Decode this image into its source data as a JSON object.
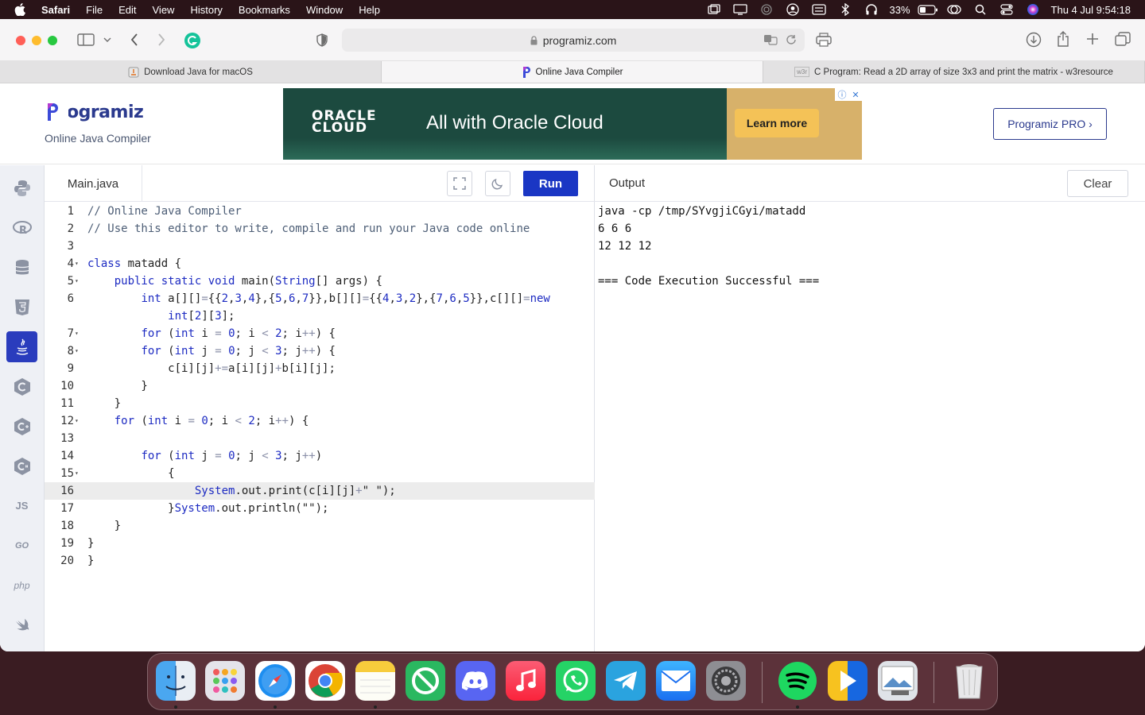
{
  "menubar": {
    "apple": "",
    "app": "Safari",
    "items": [
      "File",
      "Edit",
      "View",
      "History",
      "Bookmarks",
      "Window",
      "Help"
    ],
    "battery": "33%",
    "datetime": "Thu 4 Jul  9:54:18"
  },
  "browser": {
    "url": "programiz.com",
    "tabs": [
      {
        "label": "Download Java for macOS"
      },
      {
        "label": "Online Java Compiler"
      },
      {
        "label": "C Program: Read a 2D array of size 3x3 and print the matrix - w3resource"
      }
    ],
    "favicon_w3r": "w3r"
  },
  "site": {
    "logo": "Programiz",
    "subtitle": "Online Java Compiler",
    "pro_button": "Programiz PRO ›"
  },
  "ad": {
    "brand_line1": "ORACLE",
    "brand_line2": "CLOUD",
    "tagline": "All with Oracle Cloud",
    "cta": "Learn more"
  },
  "languages": [
    "python",
    "r",
    "sql",
    "html",
    "java",
    "c",
    "cpp",
    "csharp",
    "js",
    "go",
    "php",
    "swift"
  ],
  "lang_labels": {
    "js": "JS",
    "go": "GO",
    "php": "php"
  },
  "editor": {
    "filename": "Main.java",
    "run_label": "Run",
    "active_line": 16
  },
  "output": {
    "title": "Output",
    "clear_label": "Clear",
    "lines": [
      "java -cp /tmp/SYvgjiCGyi/matadd",
      "6 6 6 ",
      "12 12 12 ",
      "",
      "=== Code Execution Successful ==="
    ]
  },
  "dock": [
    "Finder",
    "Launchpad",
    "Safari",
    "Chrome",
    "Notes",
    "Blocker",
    "Discord",
    "Music",
    "WhatsApp",
    "Telegram",
    "Mail",
    "System Settings",
    "Spotify",
    "Infuse",
    "Preview",
    "Trash"
  ]
}
